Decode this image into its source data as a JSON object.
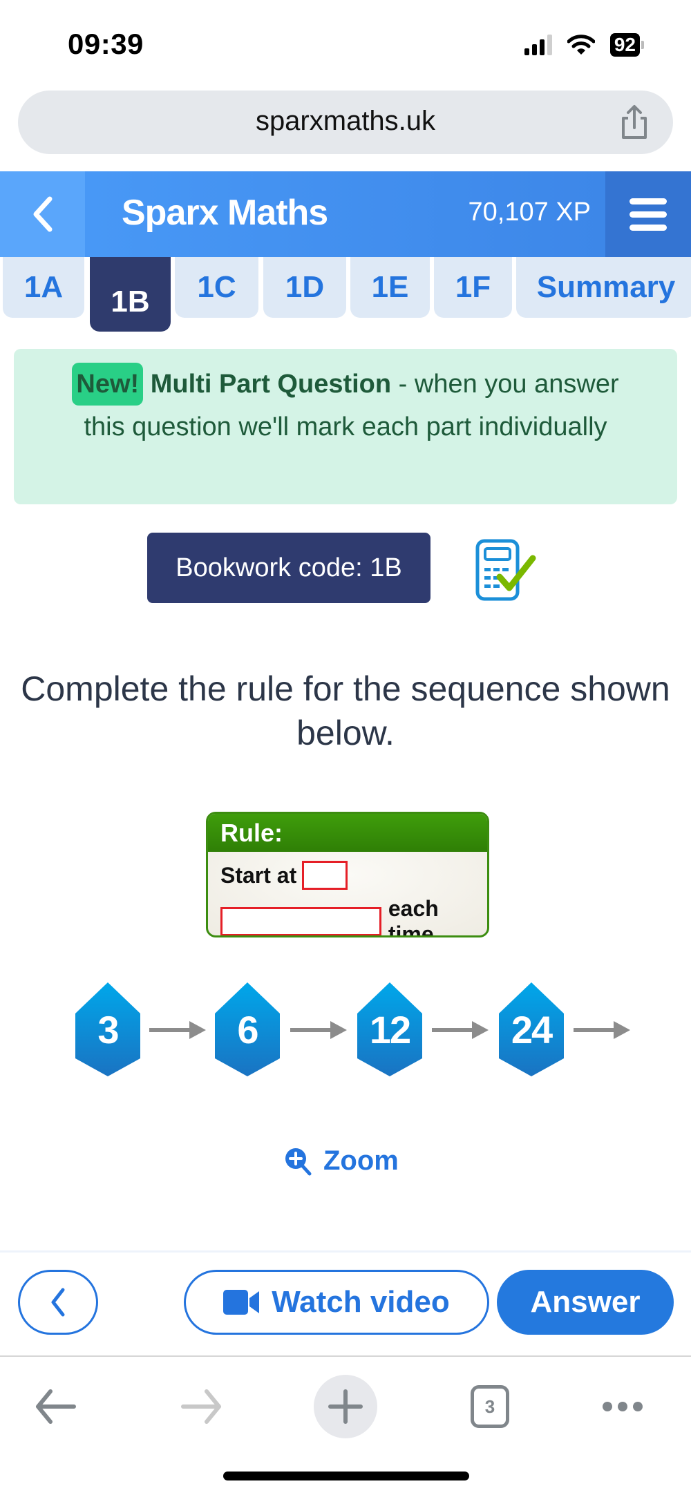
{
  "status_bar": {
    "time": "09:39",
    "battery": "92",
    "icons": [
      "signal-icon",
      "wifi-icon",
      "battery-icon"
    ]
  },
  "browser": {
    "url": "sparxmaths.uk",
    "share_icon": "share-icon",
    "toolbar": {
      "back_icon": "arrow-left-icon",
      "forward_icon": "arrow-right-icon",
      "new_tab_icon": "plus-icon",
      "tab_count": "3",
      "more_icon": "ellipsis-icon"
    }
  },
  "header": {
    "back_icon": "chevron-left-icon",
    "title": "Sparx Maths",
    "xp": "70,107 XP",
    "menu_icon": "hamburger-menu-icon"
  },
  "tabs": [
    {
      "label": "1A",
      "active": false
    },
    {
      "label": "1B",
      "active": true
    },
    {
      "label": "1C",
      "active": false
    },
    {
      "label": "1D",
      "active": false
    },
    {
      "label": "1E",
      "active": false
    },
    {
      "label": "1F",
      "active": false
    },
    {
      "label": "Summary",
      "active": false
    }
  ],
  "banner": {
    "badge": "New!",
    "title": "Multi Part Question",
    "text": " - when you answer this question we'll mark each part individually"
  },
  "bookwork": {
    "label": "Bookwork code: 1B",
    "calculator_icon": "calculator-allowed-icon"
  },
  "question": {
    "text": "Complete the rule for the sequence shown below."
  },
  "rule_card": {
    "heading": "Rule:",
    "start_label": "Start at",
    "start_value": "",
    "step_value": "",
    "step_suffix": "each time"
  },
  "sequence": {
    "terms": [
      "3",
      "6",
      "12",
      "24"
    ],
    "colors": {
      "hex_top": "#00a7ea",
      "hex_bottom": "#1a73c2",
      "arrow": "#8c8c8c"
    }
  },
  "zoom": {
    "label": "Zoom",
    "icon": "zoom-in-icon"
  },
  "actions": {
    "prev_icon": "chevron-left-icon",
    "watch_video_label": "Watch video",
    "video_icon": "video-camera-icon",
    "answer_label": "Answer"
  },
  "colors": {
    "brand_blue": "#2479de",
    "navy": "#2f3b6d",
    "banner_bg": "#d4f3e6",
    "badge_green": "#29cf86",
    "rule_green": "#3c8d10",
    "rule_box_red": "#e51f27"
  }
}
